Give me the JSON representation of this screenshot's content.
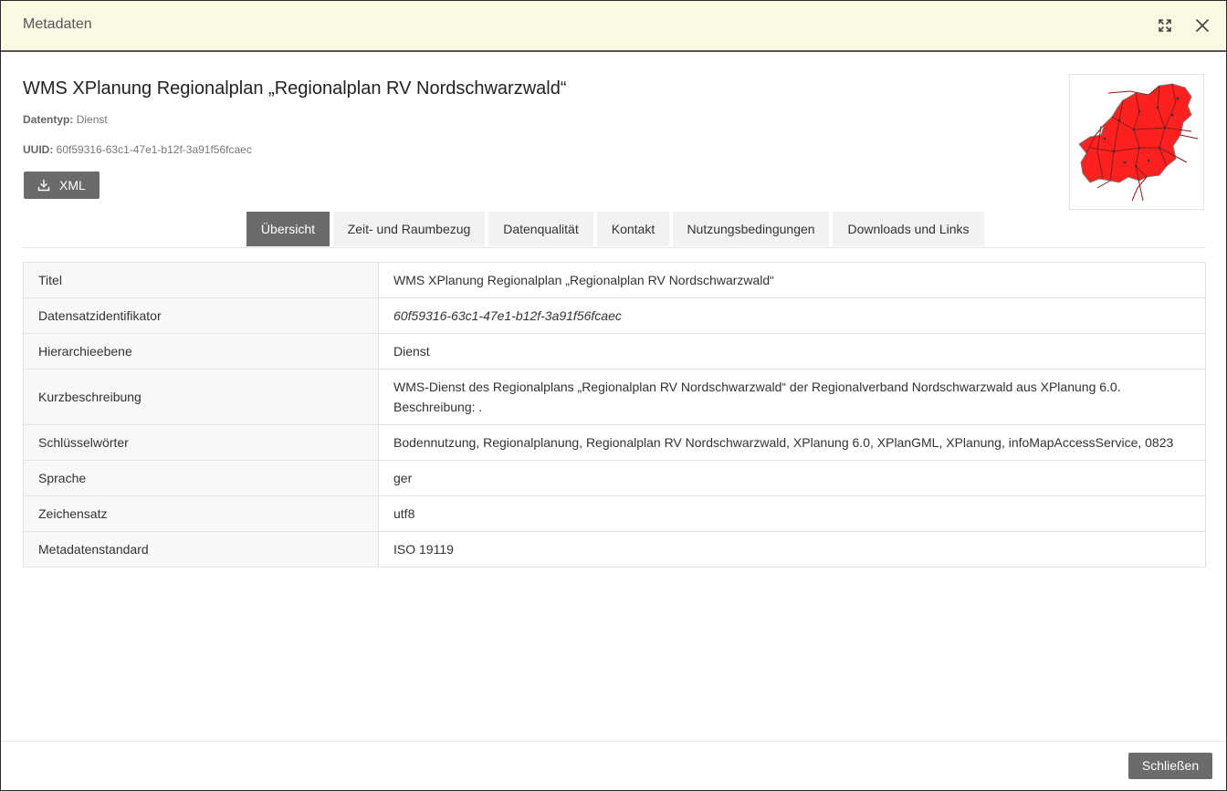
{
  "modal": {
    "title": "Metadaten"
  },
  "record": {
    "title": "WMS XPlanung Regionalplan „Regionalplan RV Nordschwarzwald“",
    "datatype_label": "Datentyp:",
    "datatype_value": "Dienst",
    "uuid_label": "UUID:",
    "uuid_value": "60f59316-63c1-47e1-b12f-3a91f56fcaec",
    "xml_button": "XML"
  },
  "tabs": [
    {
      "label": "Übersicht",
      "active": true
    },
    {
      "label": "Zeit- und Raumbezug",
      "active": false
    },
    {
      "label": "Datenqualität",
      "active": false
    },
    {
      "label": "Kontakt",
      "active": false
    },
    {
      "label": "Nutzungsbedingungen",
      "active": false
    },
    {
      "label": "Downloads und Links",
      "active": false
    }
  ],
  "overview": {
    "rows": [
      {
        "key": "Titel",
        "value": "WMS XPlanung Regionalplan „Regionalplan RV Nordschwarzwald“"
      },
      {
        "key": "Datensatzidentifikator",
        "value": "60f59316-63c1-47e1-b12f-3a91f56fcaec"
      },
      {
        "key": "Hierarchieebene",
        "value": "Dienst"
      },
      {
        "key": "Kurzbeschreibung",
        "value": "WMS-Dienst des Regionalplans „Regionalplan RV Nordschwarzwald“ der Regionalverband Nordschwarzwald aus XPlanung 6.0.",
        "value2": "Beschreibung: ."
      },
      {
        "key": "Schlüsselwörter",
        "value": "Bodennutzung, Regionalplanung, Regionalplan RV Nordschwarzwald, XPlanung 6.0, XPlanGML, XPlanung, infoMapAccessService, 0823"
      },
      {
        "key": "Sprache",
        "value": "ger"
      },
      {
        "key": "Zeichensatz",
        "value": "utf8"
      },
      {
        "key": "Metadatenstandard",
        "value": "ISO 19119"
      }
    ]
  },
  "footer": {
    "close_button": "Schließen"
  },
  "icons": {
    "expand": "expand-icon",
    "close": "close-icon",
    "download": "download-icon"
  },
  "colors": {
    "header_bg": "#fbf8e3",
    "button_bg": "#6b6b6b",
    "map_fill": "#ff2020"
  }
}
